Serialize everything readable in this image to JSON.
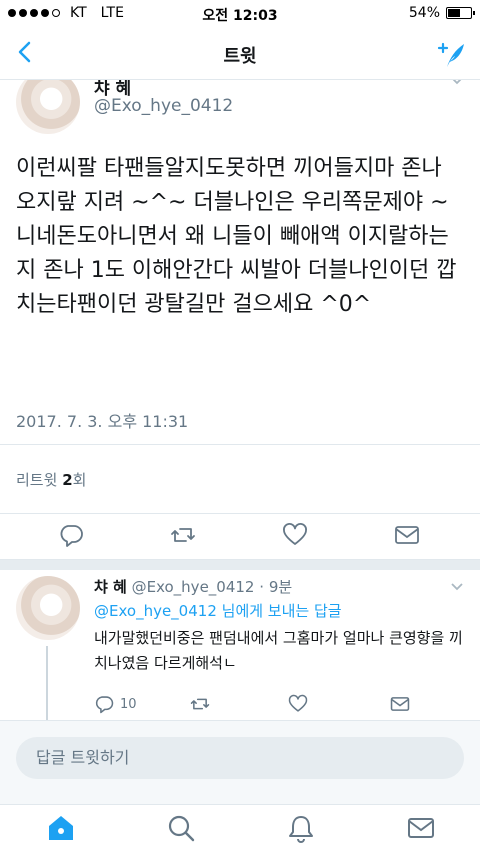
{
  "status_bar": {
    "carrier": "KT",
    "network": "LTE",
    "time": "오전 12:03",
    "battery": "54%",
    "battery_level": 0.54
  },
  "nav": {
    "title": "트윗"
  },
  "tweet": {
    "name": "챠 혜",
    "handle": "@Exo_hye_0412",
    "text": "이런씨팔 타팬들알지도못하면 끼어들지마 존나 오지랖 지려 ~^~ 더블나인은 우리쪽문제야 ~ 니네돈도아니면서 왜 니들이 빼애액 이지랄하는지 존나 1도 이해안간다 씨발아 더블나인이던 깝치는타팬이던 광탈길만 걸으세요 ^0^",
    "timestamp": "2017. 7. 3. 오후 11:31",
    "retweets_label": "리트윗",
    "retweets_count": "2",
    "retweets_suffix": "회"
  },
  "reply": {
    "name": "챠 혜",
    "handle": "@Exo_hye_0412",
    "time": "9분",
    "replying_to": "@Exo_hye_0412",
    "replying_suffix": "님에게 보내는 답글",
    "text": "내가말했던비중은 팬덤내에서 그홈마가 얼마나 큰영향을 끼치나였음 다르게해석ㄴ",
    "reply_count": "10"
  },
  "reply_bar": {
    "placeholder": "답글 트윗하기"
  },
  "colors": {
    "accent": "#1da1f2",
    "muted": "#657786",
    "text": "#14171a"
  }
}
